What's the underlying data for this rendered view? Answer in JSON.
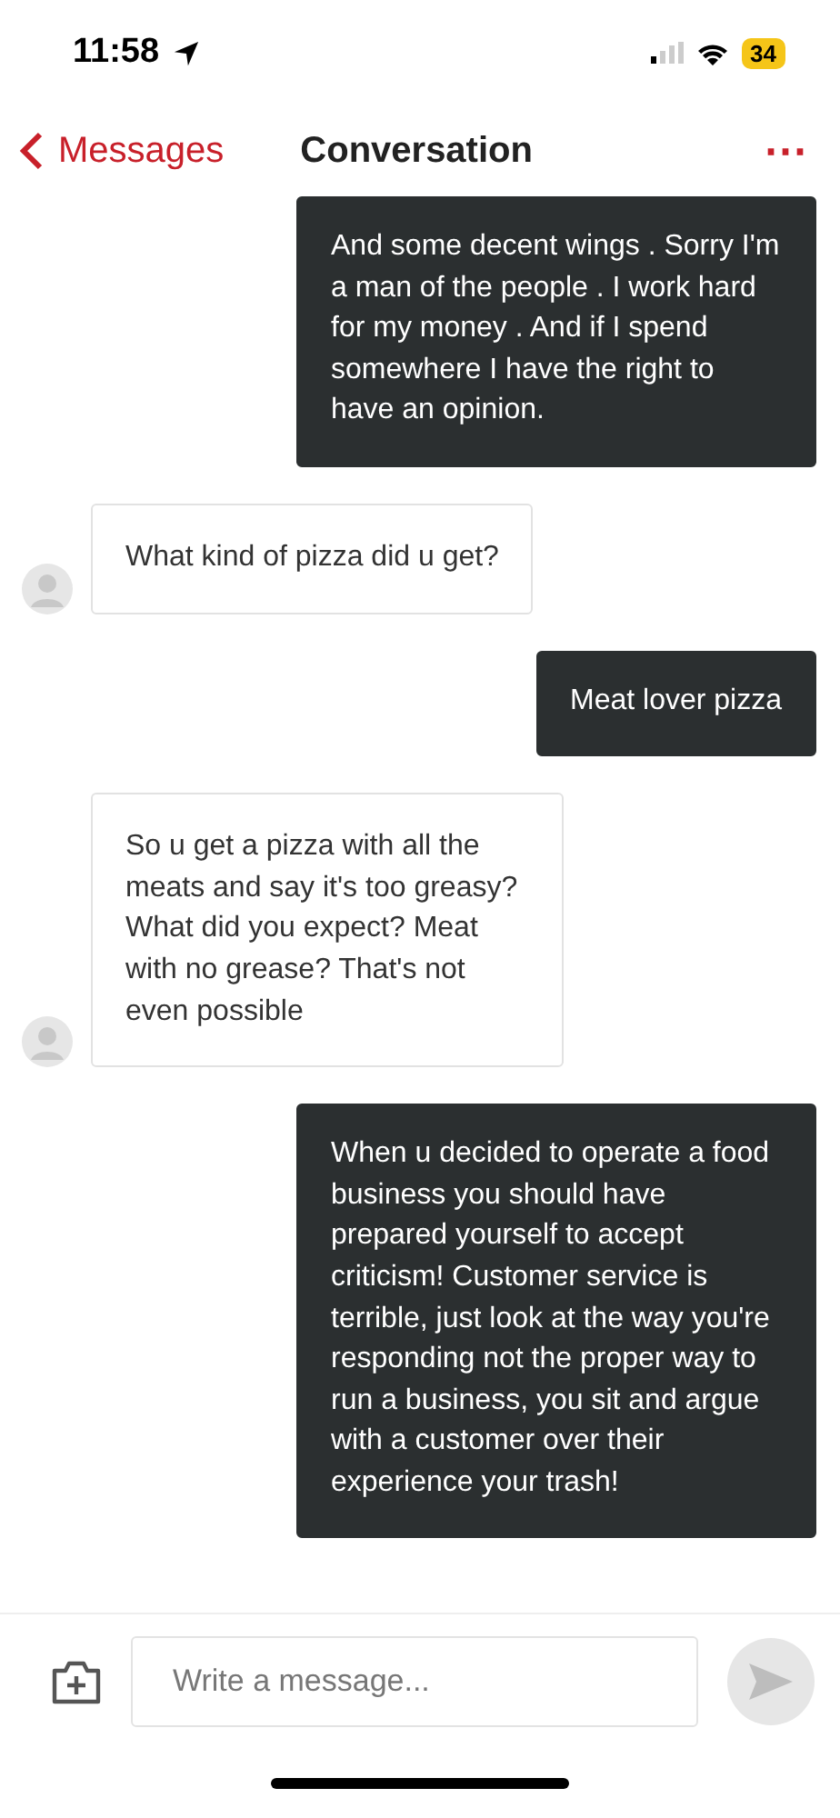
{
  "status_bar": {
    "time": "11:58",
    "battery": "34"
  },
  "header": {
    "back": "Messages",
    "title": "Conversation",
    "more": "⋯"
  },
  "messages": [
    {
      "kind": "sent",
      "text": "And some decent wings . Sorry I'm a man of the people . I work hard for my money . And if I spend somewhere I have the right to have an opinion."
    },
    {
      "kind": "received",
      "text": "What kind of pizza did u get?"
    },
    {
      "kind": "sent",
      "text": "Meat lover pizza"
    },
    {
      "kind": "received",
      "text": "So u get a pizza with all the meats and say it's too greasy? What did you expect? Meat with no grease? That's not even possible"
    },
    {
      "kind": "sent",
      "text": "When u decided to operate a food business you should have prepared yourself to accept criticism! Customer service  is terrible, just look at the way you're responding not the proper way to run a business, you sit and argue with a customer over their experience your trash!"
    }
  ],
  "composer": {
    "placeholder": "Write a message..."
  }
}
